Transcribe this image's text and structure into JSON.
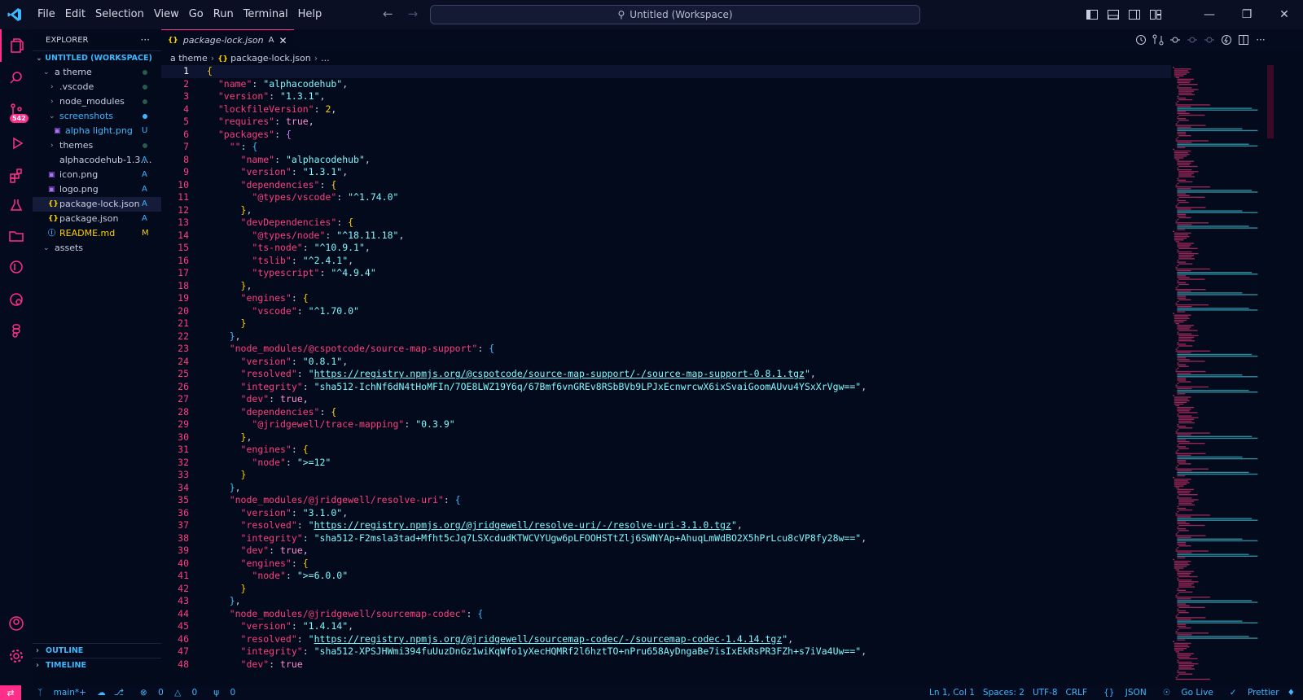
{
  "menu": [
    "File",
    "Edit",
    "Selection",
    "View",
    "Go",
    "Run",
    "Terminal",
    "Help"
  ],
  "command_center": "Untitled (Workspace)",
  "colors": {
    "accent": "#ff2e88",
    "blue": "#3db8ff",
    "cyan": "#7df9ff",
    "yellow": "#ffd000",
    "bg": "#020a1c"
  },
  "activity": {
    "badge": "542"
  },
  "sidebar": {
    "title": "EXPLORER",
    "more": "···",
    "workspace": "UNTITLED (WORKSPACE)",
    "outline": "OUTLINE",
    "timeline": "TIMELINE",
    "items": [
      {
        "label": "a theme",
        "status": ""
      },
      {
        "label": ".vscode",
        "status": ""
      },
      {
        "label": "node_modules",
        "status": ""
      },
      {
        "label": "screenshots",
        "status": ""
      },
      {
        "label": "alpha light.png",
        "status": "U"
      },
      {
        "label": "themes",
        "status": ""
      },
      {
        "label": "alphacodehub-1.3....",
        "status": "A"
      },
      {
        "label": "icon.png",
        "status": "A"
      },
      {
        "label": "logo.png",
        "status": "A"
      },
      {
        "label": "package-lock.json",
        "status": "A"
      },
      {
        "label": "package.json",
        "status": "A"
      },
      {
        "label": "README.md",
        "status": "M"
      },
      {
        "label": "assets",
        "status": ""
      }
    ]
  },
  "editor": {
    "tab": {
      "label": "package-lock.json",
      "status": "A",
      "icon": "{}"
    },
    "breadcrumb": {
      "folder": "a theme",
      "file": "package-lock.json",
      "more": "..."
    }
  },
  "code_lines": [
    "{",
    "  \"name\": \"alphacodehub\",",
    "  \"version\": \"1.3.1\",",
    "  \"lockfileVersion\": 2,",
    "  \"requires\": true,",
    "  \"packages\": {",
    "    \"\": {",
    "      \"name\": \"alphacodehub\",",
    "      \"version\": \"1.3.1\",",
    "      \"dependencies\": {",
    "        \"@types/vscode\": \"^1.74.0\"",
    "      },",
    "      \"devDependencies\": {",
    "        \"@types/node\": \"^18.11.18\",",
    "        \"ts-node\": \"^10.9.1\",",
    "        \"tslib\": \"^2.4.1\",",
    "        \"typescript\": \"^4.9.4\"",
    "      },",
    "      \"engines\": {",
    "        \"vscode\": \"^1.70.0\"",
    "      }",
    "    },",
    "    \"node_modules/@cspotcode/source-map-support\": {",
    "      \"version\": \"0.8.1\",",
    "      \"resolved\": \"https://registry.npmjs.org/@cspotcode/source-map-support/-/source-map-support-0.8.1.tgz\",",
    "      \"integrity\": \"sha512-IchNf6dN4tHoMFIn/7OE8LWZ19Y6q/67Bmf6vnGREv8RSbBVb9LPJxEcnwrcwX6ixSvaiGoomAUvu4YSxXrVgw==\",",
    "      \"dev\": true,",
    "      \"dependencies\": {",
    "        \"@jridgewell/trace-mapping\": \"0.3.9\"",
    "      },",
    "      \"engines\": {",
    "        \"node\": \">=12\"",
    "      }",
    "    },",
    "    \"node_modules/@jridgewell/resolve-uri\": {",
    "      \"version\": \"3.1.0\",",
    "      \"resolved\": \"https://registry.npmjs.org/@jridgewell/resolve-uri/-/resolve-uri-3.1.0.tgz\",",
    "      \"integrity\": \"sha512-F2msla3tad+Mfht5cJq7LSXcdudKTWCVYUgw6pLFOOHSTtZlj6SWNYAp+AhuqLmWdBO2X5hPrLcu8cVP8fy28w==\",",
    "      \"dev\": true,",
    "      \"engines\": {",
    "        \"node\": \">=6.0.0\"",
    "      }",
    "    },",
    "    \"node_modules/@jridgewell/sourcemap-codec\": {",
    "      \"version\": \"1.4.14\",",
    "      \"resolved\": \"https://registry.npmjs.org/@jridgewell/sourcemap-codec/-/sourcemap-codec-1.4.14.tgz\",",
    "      \"integrity\": \"sha512-XPSJHWmi394fuUuzDnGz1wiKqWfo1yXecHQMRf2l6hztTO+nPru658AyDngaBe7isIxEkRsPR3FZh+s7iVa4Uw==\",",
    "      \"dev\": true"
  ],
  "status": {
    "branch": "main*+",
    "errors": "0",
    "warnings": "0",
    "ports": "0",
    "position": "Ln 1, Col 1",
    "spaces": "Spaces: 2",
    "encoding": "UTF-8",
    "eol": "CRLF",
    "language": "JSON",
    "golive": "Go Live",
    "prettier": "Prettier"
  }
}
